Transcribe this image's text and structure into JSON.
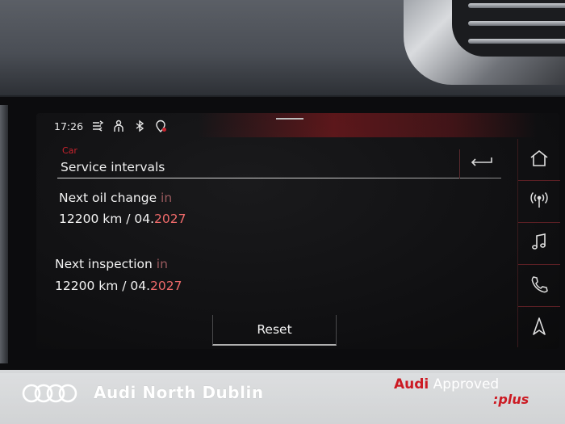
{
  "status_bar": {
    "time": "17:26",
    "icons": [
      "connected-services-icon",
      "person-icon",
      "bluetooth-icon",
      "location-icon"
    ]
  },
  "header": {
    "breadcrumb": "Car",
    "title": "Service intervals"
  },
  "oil_change": {
    "label_main": "Next oil change ",
    "label_dim": "in",
    "distance": "12200 km",
    "separator": " / ",
    "date_prefix": "04.",
    "date_suffix": "2027"
  },
  "inspection": {
    "label_main": "Next inspection ",
    "label_dim": "in",
    "distance": "12200 km",
    "separator": " / ",
    "date_prefix": "04.",
    "date_suffix": "2027"
  },
  "actions": {
    "reset_label": "Reset"
  },
  "side_rail": [
    "home-icon",
    "radio-antenna-icon",
    "music-note-icon",
    "phone-icon",
    "navigation-arrow-icon"
  ],
  "branding": {
    "dealer": "Audi North Dublin",
    "approved_brand": "Audi",
    "approved_word": " Approved",
    "approved_plus": ":plus"
  },
  "colors": {
    "accent_red": "#c8232d",
    "date_red": "#ef6a6a",
    "screen_bg": "#0f0f11"
  }
}
